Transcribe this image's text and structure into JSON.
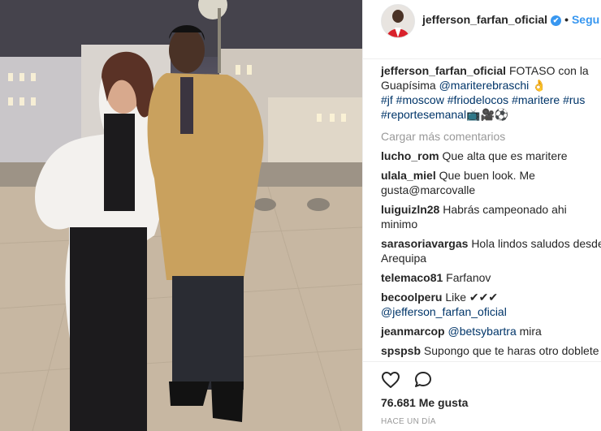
{
  "post": {
    "username": "jefferson_farfan_oficial",
    "follow_label": "Segu",
    "caption_text": "FOTASO con la Guapísima",
    "caption_mention": "@mariterebraschi",
    "caption_emoji": "👌",
    "hashtags": "#jf #moscow #friodelocos #maritere #rus #reportesemanal",
    "hashtag_emoji": "📺🎥⚽"
  },
  "load_more": "Cargar más comentarios",
  "comments": [
    {
      "user": "lucho_rom",
      "text": "Que alta que es maritere"
    },
    {
      "user": "ulala_miel",
      "text": "Que buen look. Me gusta@marcovalle"
    },
    {
      "user": "luiguizln28",
      "text": "Habrás campeonado ahi minimo"
    },
    {
      "user": "sarasoriavargas",
      "text": "Hola lindos saludos desde Arequipa"
    },
    {
      "user": "telemaco81",
      "text": "Farfanov"
    },
    {
      "user": "becoolperu",
      "text": "Like ✔✔✔",
      "mention": "@jefferson_farfan_oficial"
    },
    {
      "user": "jeanmarcop",
      "mention": "@betsybartra",
      "text": "mira"
    },
    {
      "user": "spspsb",
      "text": "Supongo que te haras otro doblete"
    }
  ],
  "likes": "76.681 Me gusta",
  "timestamp": "HACE UN DÍA",
  "icons": [
    "heart-icon",
    "comment-icon",
    "verified-badge-icon"
  ]
}
